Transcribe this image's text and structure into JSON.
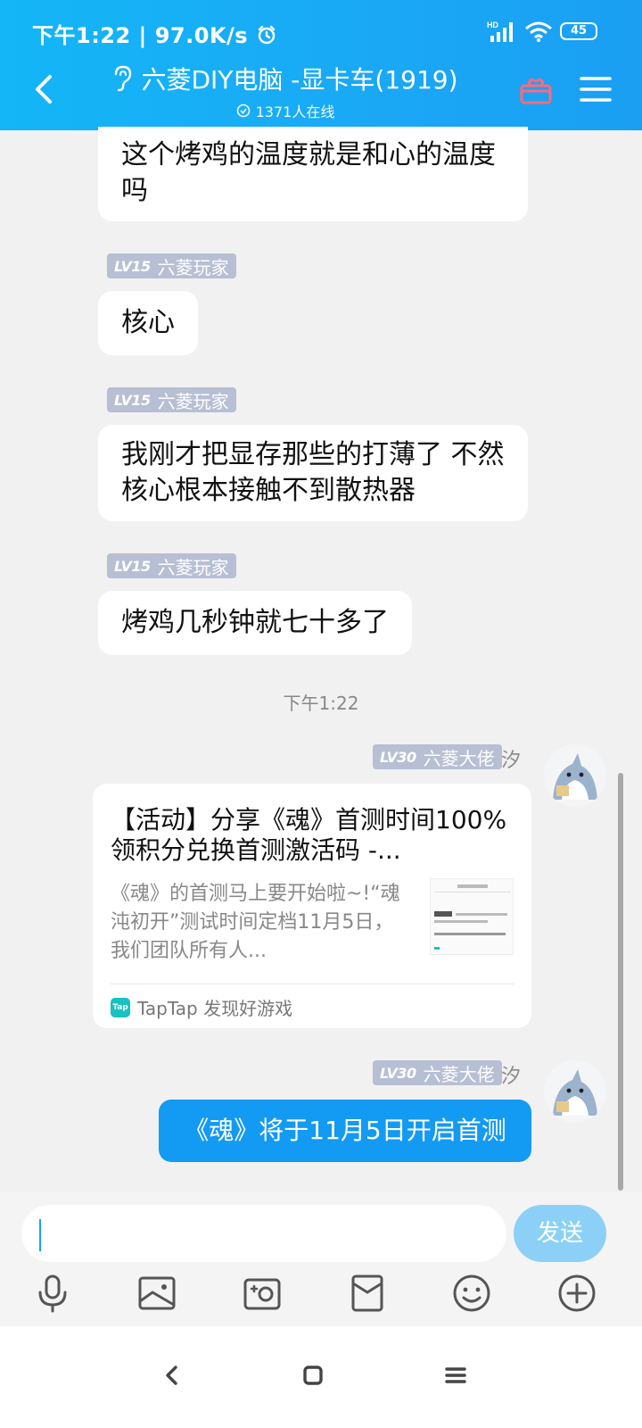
{
  "status_bar": {
    "time": "下午1:22",
    "speed": "97.0K/s",
    "battery": "45",
    "hd": "HD"
  },
  "header": {
    "title": "六菱DIY电脑 -显卡车(1919)",
    "online": "1371人在线"
  },
  "messages": [
    {
      "text": "这个烤鸡的温度就是和心的温度吗"
    },
    {
      "badge_level": "LV15",
      "badge_title": "六菱玩家",
      "text": "核心"
    },
    {
      "badge_level": "LV15",
      "badge_title": "六菱玩家",
      "text": "我刚才把显存那些的打薄了 不然核心根本接触不到散热器"
    },
    {
      "badge_level": "LV15",
      "badge_title": "六菱玩家",
      "text": "烤鸡几秒钟就七十多了"
    }
  ],
  "timestamp": "下午1:22",
  "share_message": {
    "badge_level": "LV30",
    "badge_title": "六菱大佬",
    "sender": "汐",
    "title": "【活动】分享《魂》首测时间100%领积分兑换首测激活码 -...",
    "desc": "《魂》的首测马上要开始啦~!“魂沌初开”测试时间定档11月5日，我们团队所有人...",
    "source": "TapTap 发现好游戏",
    "source_logo": "Tap"
  },
  "my_message": {
    "badge_level": "LV30",
    "badge_title": "六菱大佬",
    "sender": "汐",
    "text": "《魂》将于11月5日开启首测"
  },
  "input": {
    "placeholder": "",
    "send_label": "发送"
  },
  "colors": {
    "header_blue": "#1aa8f5",
    "my_bubble": "#139af2",
    "send_btn": "#8cd0f7",
    "badge": "#b7bfd4"
  }
}
